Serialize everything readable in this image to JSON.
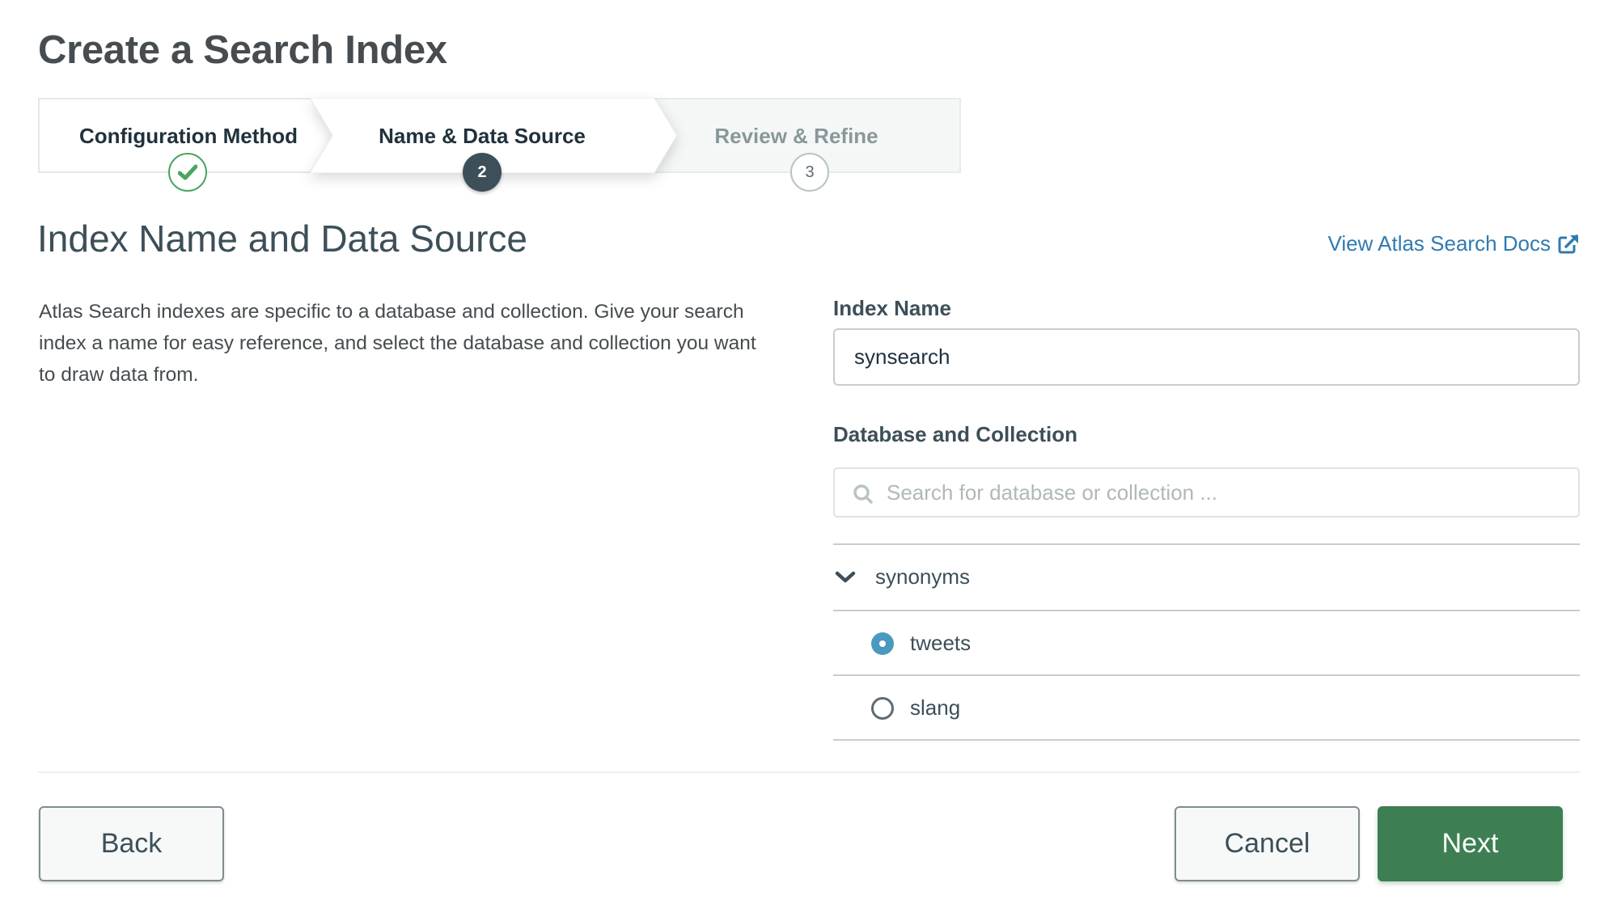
{
  "page": {
    "title": "Create a Search Index"
  },
  "stepper": {
    "steps": [
      {
        "label": "Configuration Method",
        "number": "1",
        "state": "completed"
      },
      {
        "label": "Name & Data Source",
        "number": "2",
        "state": "active"
      },
      {
        "label": "Review & Refine",
        "number": "3",
        "state": "upcoming"
      }
    ]
  },
  "section": {
    "title": "Index Name and Data Source",
    "docs_link": "View Atlas Search Docs",
    "description": "Atlas Search indexes are specific to a database and collection. Give your search index a name for easy reference, and select the database and collection you want to draw data from."
  },
  "form": {
    "index_name_label": "Index Name",
    "index_name_value": "synsearch",
    "db_collection_label": "Database and Collection",
    "search_placeholder": "Search for database or collection ...",
    "search_value": ""
  },
  "tree": {
    "database": {
      "name": "synonyms",
      "expanded": true
    },
    "collections": [
      {
        "name": "tweets",
        "selected": true
      },
      {
        "name": "slang",
        "selected": false
      }
    ]
  },
  "footer": {
    "back_label": "Back",
    "cancel_label": "Cancel",
    "next_label": "Next"
  },
  "colors": {
    "primary_green": "#3d7f52",
    "link_blue": "#2f7bb0",
    "radio_blue": "#4a9ac0",
    "success_green": "#4aa561"
  }
}
